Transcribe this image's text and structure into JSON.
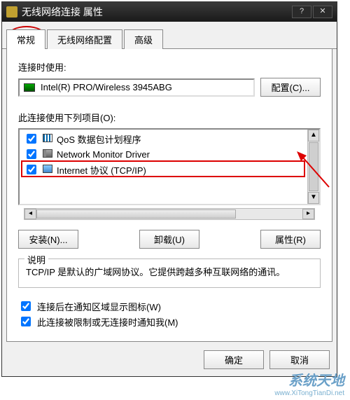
{
  "window": {
    "title": "无线网络连接 属性"
  },
  "tabs": {
    "general": "常规",
    "wireless": "无线网络配置",
    "advanced": "高级"
  },
  "connect_using_label": "连接时使用:",
  "adapter_name": "Intel(R) PRO/Wireless 3945ABG",
  "configure_button": "配置(C)...",
  "items_label": "此连接使用下列项目(O):",
  "items": [
    {
      "checked": true,
      "text": "QoS 数据包计划程序",
      "icon": "qos"
    },
    {
      "checked": true,
      "text": "Network Monitor Driver",
      "icon": "nm"
    },
    {
      "checked": true,
      "text": "Internet 协议 (TCP/IP)",
      "icon": "tcp"
    }
  ],
  "install_button": "安装(N)...",
  "uninstall_button": "卸载(U)",
  "properties_button": "属性(R)",
  "description_label": "说明",
  "description_text": "TCP/IP 是默认的广域网协议。它提供跨越多种互联网络的通讯。",
  "notify_icon_check": "连接后在通知区域显示图标(W)",
  "notify_limited_check": "此连接被限制或无连接时通知我(M)",
  "ok_button": "确定",
  "cancel_button": "取消",
  "watermark": {
    "line1": "系统天地",
    "line2": "www.XiTongTianDi.net"
  }
}
